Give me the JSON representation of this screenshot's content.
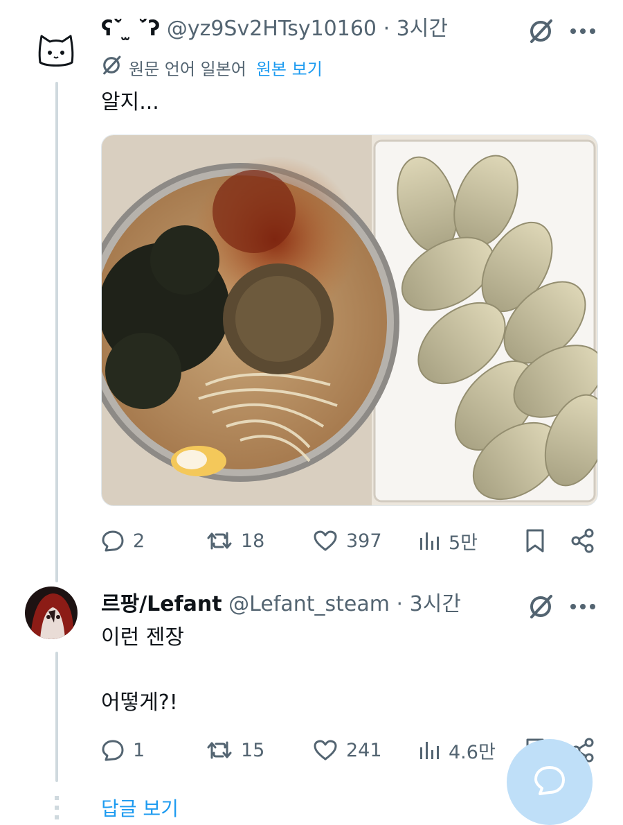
{
  "tweet1": {
    "display_name": "ʕ˘̀ ̫ ˘́ʔ",
    "handle": "@yz9Sv2HTsy10160",
    "separator": "·",
    "time": "3시간",
    "translation_label": "원문 언어 일본어",
    "translation_link": "원본 보기",
    "text": "알지...",
    "stats": {
      "replies": "2",
      "reposts": "18",
      "likes": "397",
      "views": "5만"
    }
  },
  "tweet2": {
    "display_name": "르팡/Lefant",
    "handle": "@Lefant_steam",
    "separator": "·",
    "time": "3시간",
    "text_line1": "이런 젠장",
    "text_line2": "어떻게?!",
    "stats": {
      "replies": "1",
      "reposts": "15",
      "likes": "241",
      "views": "4.6만"
    }
  },
  "show_replies": "답글 보기",
  "icons": [
    "cat-avatar-icon",
    "translate-icon",
    "more-icon",
    "reply-icon",
    "repost-icon",
    "like-icon",
    "views-icon",
    "bookmark-icon",
    "share-icon",
    "compose-reply-icon"
  ],
  "colors": {
    "link": "#1d9bf0",
    "muted": "#536471",
    "text": "#0f1419",
    "fab": "#bfdff8"
  }
}
